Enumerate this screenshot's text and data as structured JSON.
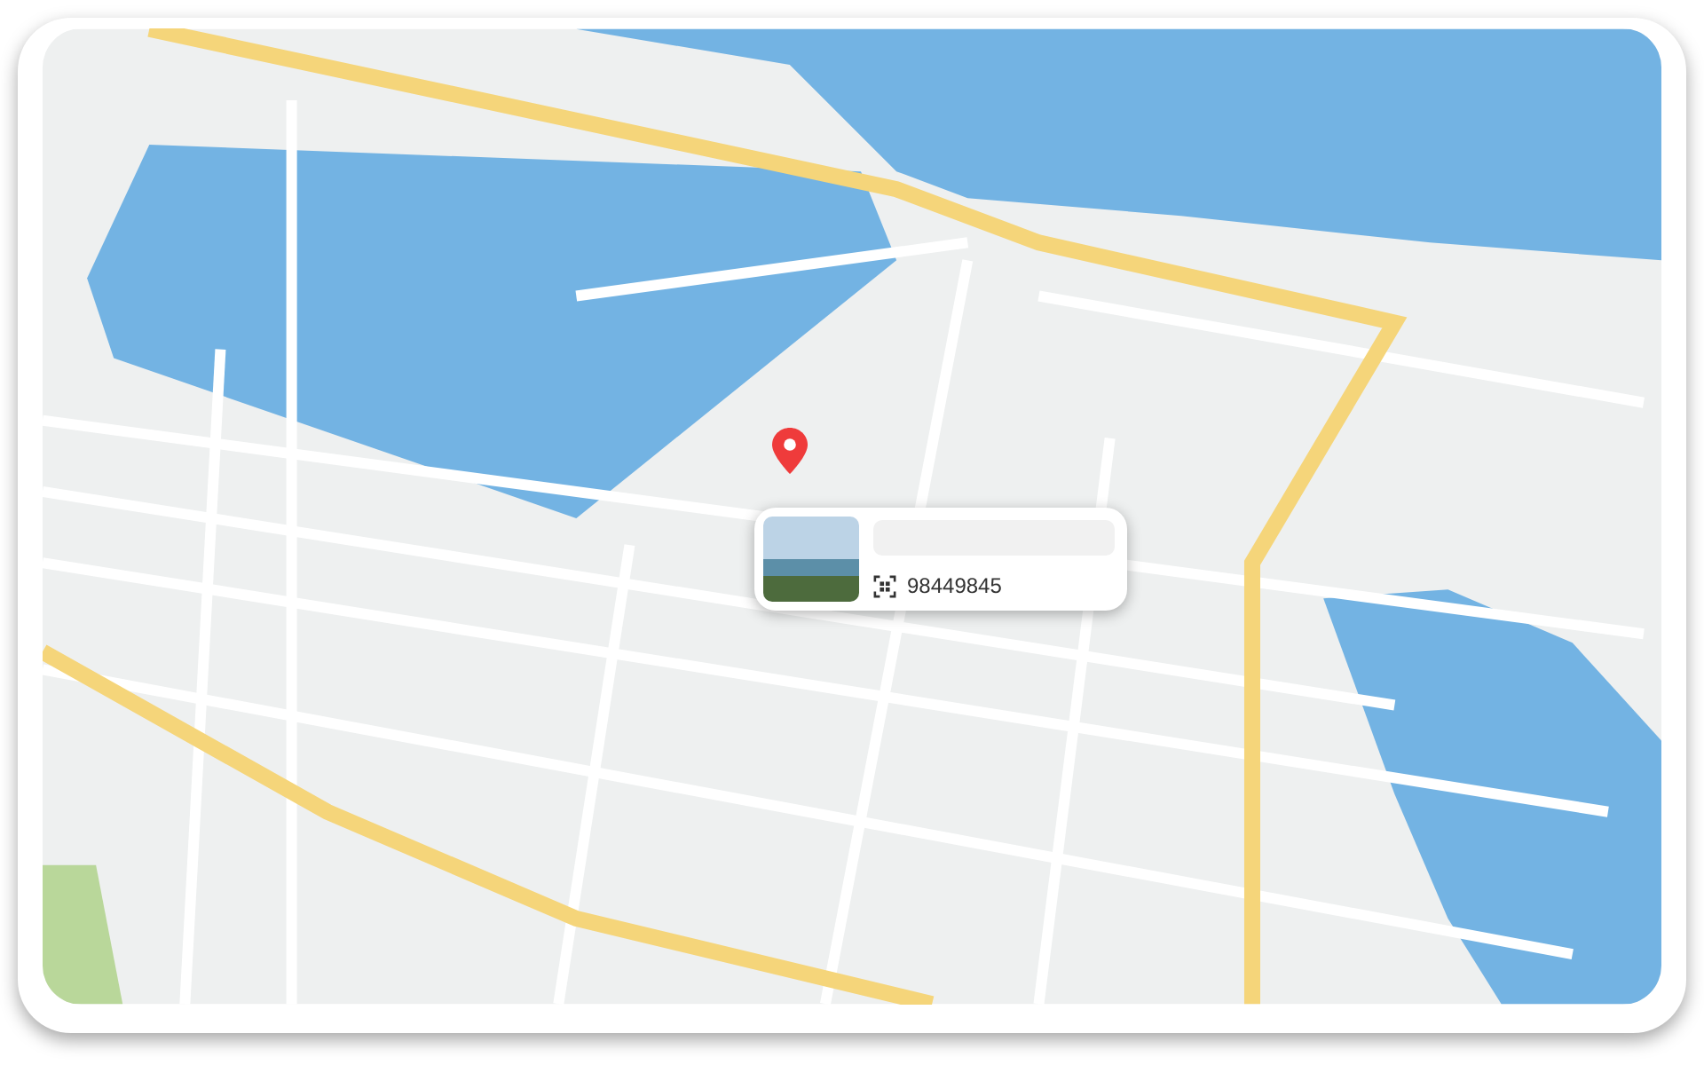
{
  "map": {
    "marker": {
      "shown": true
    }
  },
  "popup": {
    "phone": "98449845"
  }
}
